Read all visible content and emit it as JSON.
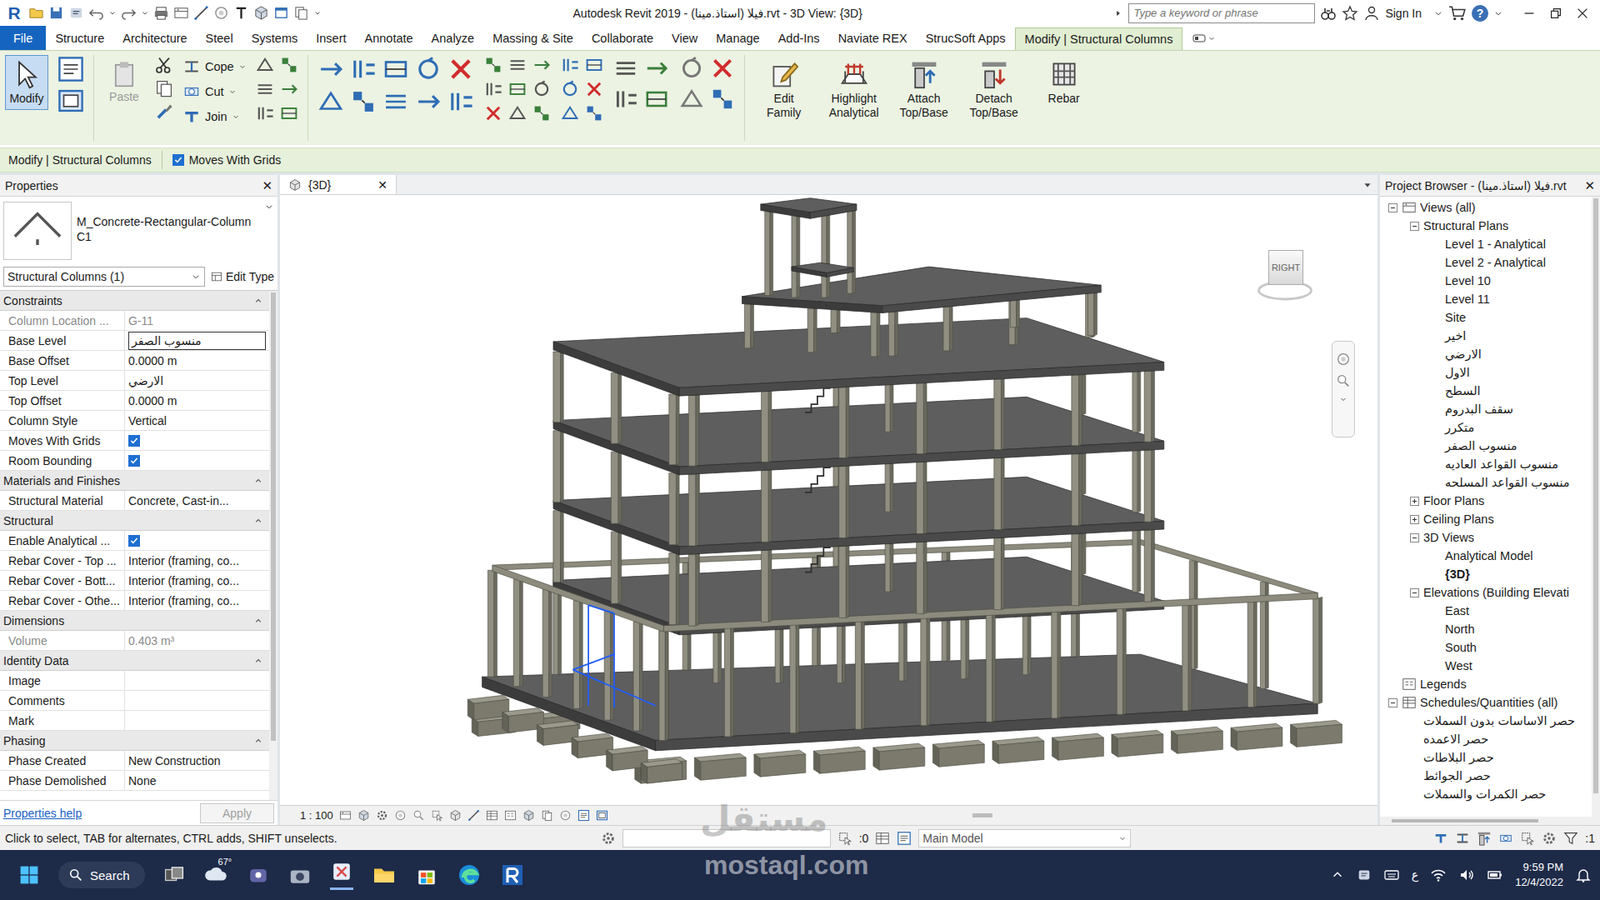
{
  "window": {
    "app_logo": "R",
    "title": "Autodesk Revit 2019 - فيلا (استاذ.مينا).rvt - 3D View: {3D}",
    "search_placeholder": "Type a keyword or phrase",
    "sign_in": "Sign In",
    "help": "?"
  },
  "ribbon_tabs": [
    {
      "label": "File",
      "kind": "file",
      "selected": false
    },
    {
      "label": "Structure",
      "kind": "tab",
      "selected": false
    },
    {
      "label": "Architecture",
      "kind": "tab",
      "selected": false
    },
    {
      "label": "Steel",
      "kind": "tab",
      "selected": false
    },
    {
      "label": "Systems",
      "kind": "tab",
      "selected": false
    },
    {
      "label": "Insert",
      "kind": "tab",
      "selected": false
    },
    {
      "label": "Annotate",
      "kind": "tab",
      "selected": false
    },
    {
      "label": "Analyze",
      "kind": "tab",
      "selected": false
    },
    {
      "label": "Massing & Site",
      "kind": "tab",
      "selected": false
    },
    {
      "label": "Collaborate",
      "kind": "tab",
      "selected": false
    },
    {
      "label": "View",
      "kind": "tab",
      "selected": false
    },
    {
      "label": "Manage",
      "kind": "tab",
      "selected": false
    },
    {
      "label": "Add-Ins",
      "kind": "tab",
      "selected": false
    },
    {
      "label": "Naviate REX",
      "kind": "tab",
      "selected": false
    },
    {
      "label": "StrucSoft Apps",
      "kind": "tab",
      "selected": false
    },
    {
      "label": "Modify | Structural Columns",
      "kind": "context",
      "selected": true
    }
  ],
  "ribbon": {
    "modify": {
      "label": "Modify",
      "selected": true
    },
    "paste": {
      "label": "Paste",
      "disabled": true
    },
    "edit_tools": [
      "Cope",
      "Cut",
      "Join"
    ],
    "big_tools": [
      "Edit Family",
      "Highlight Analytical",
      "Attach Top/Base",
      "Detach Top/Base",
      "Rebar"
    ]
  },
  "options_bar": {
    "context": "Modify | Structural Columns",
    "moves_with_grids": {
      "label": "Moves With Grids",
      "checked": true
    }
  },
  "properties": {
    "title": "Properties",
    "close": "✕",
    "type_name": "M_Concrete-Rectangular-Column",
    "type_sub": "C1",
    "selector": "Structural Columns (1)",
    "edit_type": "Edit Type",
    "groups": [
      {
        "name": "Constraints",
        "rows": [
          {
            "label": "Column Location ...",
            "value": "G-11",
            "kind": "text",
            "disabled": true
          },
          {
            "label": "Base Level",
            "value": "منسوب الصفر",
            "kind": "field",
            "disabled": false
          },
          {
            "label": "Base Offset",
            "value": "0.0000 m",
            "kind": "text",
            "disabled": false
          },
          {
            "label": "Top Level",
            "value": "الارضي",
            "kind": "text",
            "disabled": false
          },
          {
            "label": "Top Offset",
            "value": "0.0000 m",
            "kind": "text",
            "disabled": false
          },
          {
            "label": "Column Style",
            "value": "Vertical",
            "kind": "text",
            "disabled": false
          },
          {
            "label": "Moves With Grids",
            "kind": "check",
            "checked": true,
            "disabled": false
          },
          {
            "label": "Room Bounding",
            "kind": "check",
            "checked": true,
            "disabled": false
          }
        ]
      },
      {
        "name": "Materials and Finishes",
        "rows": [
          {
            "label": "Structural Material",
            "value": "Concrete, Cast-in...",
            "kind": "text",
            "disabled": false
          }
        ]
      },
      {
        "name": "Structural",
        "rows": [
          {
            "label": "Enable Analytical ...",
            "kind": "check",
            "checked": true,
            "disabled": false
          },
          {
            "label": "Rebar Cover - Top ...",
            "value": "Interior (framing, co...",
            "kind": "text",
            "disabled": false
          },
          {
            "label": "Rebar Cover - Bott...",
            "value": "Interior (framing, co...",
            "kind": "text",
            "disabled": false
          },
          {
            "label": "Rebar Cover - Othe...",
            "value": "Interior (framing, co...",
            "kind": "text",
            "disabled": false
          }
        ]
      },
      {
        "name": "Dimensions",
        "rows": [
          {
            "label": "Volume",
            "value": "0.403 m³",
            "kind": "text",
            "disabled": true
          }
        ]
      },
      {
        "name": "Identity Data",
        "rows": [
          {
            "label": "Image",
            "value": "",
            "kind": "text",
            "disabled": false
          },
          {
            "label": "Comments",
            "value": "",
            "kind": "text",
            "disabled": false
          },
          {
            "label": "Mark",
            "value": "",
            "kind": "text",
            "disabled": false
          }
        ]
      },
      {
        "name": "Phasing",
        "rows": [
          {
            "label": "Phase Created",
            "value": "New Construction",
            "kind": "text",
            "disabled": false
          },
          {
            "label": "Phase Demolished",
            "value": "None",
            "kind": "text",
            "disabled": false
          }
        ]
      }
    ],
    "help": "Properties help",
    "apply": "Apply",
    "apply_disabled": true
  },
  "view": {
    "tab": "{3D}",
    "close": "✕",
    "scale": "1 : 100",
    "viewcube": "RIGHT"
  },
  "project_browser": {
    "title": "Project Browser - فيلا (استاذ.مينا).rvt",
    "close": "✕",
    "tree": [
      {
        "label": "Views (all)",
        "kind": "root",
        "expanded": true,
        "selected": false,
        "children": [
          {
            "label": "Structural Plans",
            "kind": "folder",
            "expanded": true,
            "selected": false,
            "children": [
              {
                "label": "Level 1 - Analytical",
                "kind": "view",
                "selected": false
              },
              {
                "label": "Level 2 - Analytical",
                "kind": "view",
                "selected": false
              },
              {
                "label": "Level 10",
                "kind": "view",
                "selected": false
              },
              {
                "label": "Level 11",
                "kind": "view",
                "selected": false
              },
              {
                "label": "Site",
                "kind": "view",
                "selected": false
              },
              {
                "label": "اخير",
                "kind": "view",
                "selected": false
              },
              {
                "label": "الارضي",
                "kind": "view",
                "selected": false
              },
              {
                "label": "الاول",
                "kind": "view",
                "selected": false
              },
              {
                "label": "السطح",
                "kind": "view",
                "selected": false
              },
              {
                "label": "سقف البدروم",
                "kind": "view",
                "selected": false
              },
              {
                "label": "متكرر",
                "kind": "view",
                "selected": false
              },
              {
                "label": "منسوب الصفر",
                "kind": "view",
                "selected": false
              },
              {
                "label": "منسوب القواعد العاديه",
                "kind": "view",
                "selected": false
              },
              {
                "label": "منسوب القواعد المسلحه",
                "kind": "view",
                "selected": false
              }
            ]
          },
          {
            "label": "Floor Plans",
            "kind": "folder",
            "expanded": false,
            "selected": false,
            "children": []
          },
          {
            "label": "Ceiling Plans",
            "kind": "folder",
            "expanded": false,
            "selected": false,
            "children": []
          },
          {
            "label": "3D Views",
            "kind": "folder",
            "expanded": true,
            "selected": false,
            "children": [
              {
                "label": "Analytical Model",
                "kind": "view",
                "selected": false
              },
              {
                "label": "{3D}",
                "kind": "view",
                "selected": true
              }
            ]
          },
          {
            "label": "Elevations (Building Elevati",
            "kind": "folder",
            "expanded": true,
            "selected": false,
            "children": [
              {
                "label": "East",
                "kind": "view",
                "selected": false
              },
              {
                "label": "North",
                "kind": "view",
                "selected": false
              },
              {
                "label": "South",
                "kind": "view",
                "selected": false
              },
              {
                "label": "West",
                "kind": "view",
                "selected": false
              }
            ]
          }
        ]
      },
      {
        "label": "Legends",
        "kind": "root",
        "selected": false
      },
      {
        "label": "Schedules/Quantities (all)",
        "kind": "root",
        "expanded": true,
        "selected": false,
        "children": [
          {
            "label": "حصر الاساسات بدون السملات",
            "kind": "view",
            "selected": false
          },
          {
            "label": "حصر الاعمده",
            "kind": "view",
            "selected": false
          },
          {
            "label": "حصر البلاطات",
            "kind": "view",
            "selected": false
          },
          {
            "label": "حصر الجوائط",
            "kind": "view",
            "selected": false
          },
          {
            "label": "حصر الكمرات والسملات",
            "kind": "view",
            "selected": false
          }
        ]
      }
    ]
  },
  "status_bar": {
    "hint": "Click to select, TAB for alternates, CTRL adds, SHIFT unselects.",
    "selected_count": ":0",
    "model": "Main Model",
    "filter_count": ":1"
  },
  "taskbar": {
    "search": "Search",
    "weather": "67°",
    "language": "ع",
    "time": "9:59 PM",
    "date": "12/4/2022"
  },
  "watermark": {
    "arabic": "مستقل",
    "latin": "mostaql.com"
  }
}
